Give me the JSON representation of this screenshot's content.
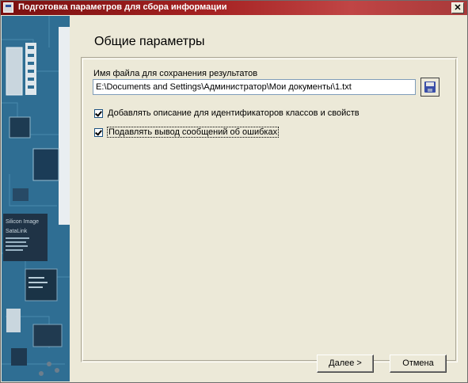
{
  "window": {
    "title": "Подготовка параметров для сбора информации",
    "close_label": "✕"
  },
  "side_image": {
    "chip_texts": [
      "Silicon Image",
      "SataLink"
    ]
  },
  "page": {
    "title": "Общие параметры"
  },
  "file_field": {
    "label": "Имя файла для сохранения результатов",
    "value": "E:\\Documents and Settings\\Администратор\\Мои документы\\1.txt"
  },
  "checkboxes": [
    {
      "label": "Добавлять описание для идентификаторов классов и свойств",
      "checked": true
    },
    {
      "label": "Подавлять вывод сообщений об ошибках",
      "checked": true
    }
  ],
  "buttons": {
    "next": "Далее >",
    "cancel": "Отмена"
  },
  "colors": {
    "titlebar": "#a52222",
    "panel": "#2f6f94",
    "dialog_bg": "#ece9d8"
  }
}
